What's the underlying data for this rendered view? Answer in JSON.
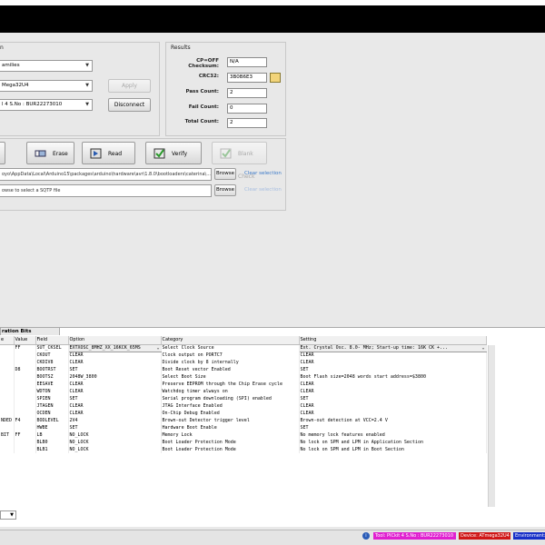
{
  "programming": {
    "title": "n",
    "family_value": "amilies",
    "device_value": "Mega32U4",
    "tool_value": "l 4 S.No : BUR22273010",
    "apply_label": "Apply",
    "disconnect_label": "Disconnect"
  },
  "results": {
    "title": "Results",
    "cpoff_label": "CP=OFF Checksum:",
    "cpoff_value": "N/A",
    "crc_label": "CRC32:",
    "crc_value": "3B0B6E3",
    "pass_label": "Pass Count:",
    "pass_value": "2",
    "fail_label": "Fail Count:",
    "fail_value": "0",
    "total_label": "Total Count:",
    "total_value": "2"
  },
  "actions": {
    "erase_label": "Erase",
    "read_label": "Read",
    "verify_label": "Verify",
    "blank_check_label": "Blank Check"
  },
  "files": {
    "hex_path": "oyo\\AppData\\Local\\Arduino15\\packages\\arduino\\hardware\\avr\\1.8.0\\bootloaders\\caterina\\...",
    "sqtp_path": "owse to select a SQTP file",
    "browse_label": "Browse",
    "clear_label": "Clear selection"
  },
  "fuse_tab": {
    "label": "ration Bits",
    "headers": [
      "e",
      "Value",
      "Field",
      "Option",
      "Category",
      "Setting"
    ],
    "rows": [
      {
        "mem": "",
        "value": "FF",
        "field": "SUT_CKSEL",
        "option": "EXTXOSC_8MHZ_XX_16KCK_65MS",
        "category": "Select Clock Source",
        "setting": "Ext. Crystal Osc. 8.0-    MHz; Start-up time: 16K CK +..."
      },
      {
        "mem": "",
        "value": "",
        "field": "CKOUT",
        "option": "CLEAR",
        "category": "Clock output on PORTC7",
        "setting": "CLEAR"
      },
      {
        "mem": "",
        "value": "",
        "field": "CKDIV8",
        "option": "CLEAR",
        "category": "Divide clock by 8 internally",
        "setting": "CLEAR"
      },
      {
        "mem": "",
        "value": "D8",
        "field": "BOOTRST",
        "option": "SET",
        "category": "Boot Reset vector Enabled",
        "setting": "SET"
      },
      {
        "mem": "",
        "value": "",
        "field": "BOOTSZ",
        "option": "2048W_3800",
        "category": "Select Boot Size",
        "setting": "Boot Flash size=2048 words start address=$3800"
      },
      {
        "mem": "",
        "value": "",
        "field": "EESAVE",
        "option": "CLEAR",
        "category": "Preserve EEPROM through the Chip Erase cycle",
        "setting": "CLEAR"
      },
      {
        "mem": "",
        "value": "",
        "field": "WDTON",
        "option": "CLEAR",
        "category": "Watchdog timer always on",
        "setting": "CLEAR"
      },
      {
        "mem": "",
        "value": "",
        "field": "SPIEN",
        "option": "SET",
        "category": "Serial program downloading (SPI) enabled",
        "setting": "SET"
      },
      {
        "mem": "",
        "value": "",
        "field": "JTAGEN",
        "option": "CLEAR",
        "category": "JTAG Interface Enabled",
        "setting": "CLEAR"
      },
      {
        "mem": "",
        "value": "",
        "field": "OCDEN",
        "option": "CLEAR",
        "category": "On-Chip Debug Enabled",
        "setting": "CLEAR"
      },
      {
        "mem": "NDED",
        "value": "F4",
        "field": "BODLEVEL",
        "option": "2V4",
        "category": "Brown-out Detector trigger level",
        "setting": "Brown-out detection at VCC=2.4 V"
      },
      {
        "mem": "",
        "value": "",
        "field": "HWBE",
        "option": "SET",
        "category": "Hardware Boot Enable",
        "setting": "SET"
      },
      {
        "mem": "BIT",
        "value": "FF",
        "field": "LB",
        "option": "NO_LOCK",
        "category": "Memory Lock",
        "setting": "No memory lock features enabled"
      },
      {
        "mem": "",
        "value": "",
        "field": "BLB0",
        "option": "NO_LOCK",
        "category": "Boot Loader Protection Mode",
        "setting": "No lock on SPM and LPM in Application Section"
      },
      {
        "mem": "",
        "value": "",
        "field": "BLB1",
        "option": "NO_LOCK",
        "category": "Boot Loader Protection Mode",
        "setting": "No lock on SPM and LPM in Boot Section"
      }
    ]
  },
  "status": {
    "tool": "Tool: PICkit 4 S.No : BUR22273010",
    "device": "Device: ATmega32U4",
    "environment": "Environment:",
    "tool_color": "#e020d0",
    "device_color": "#d01818",
    "env_color": "#1830c8"
  }
}
